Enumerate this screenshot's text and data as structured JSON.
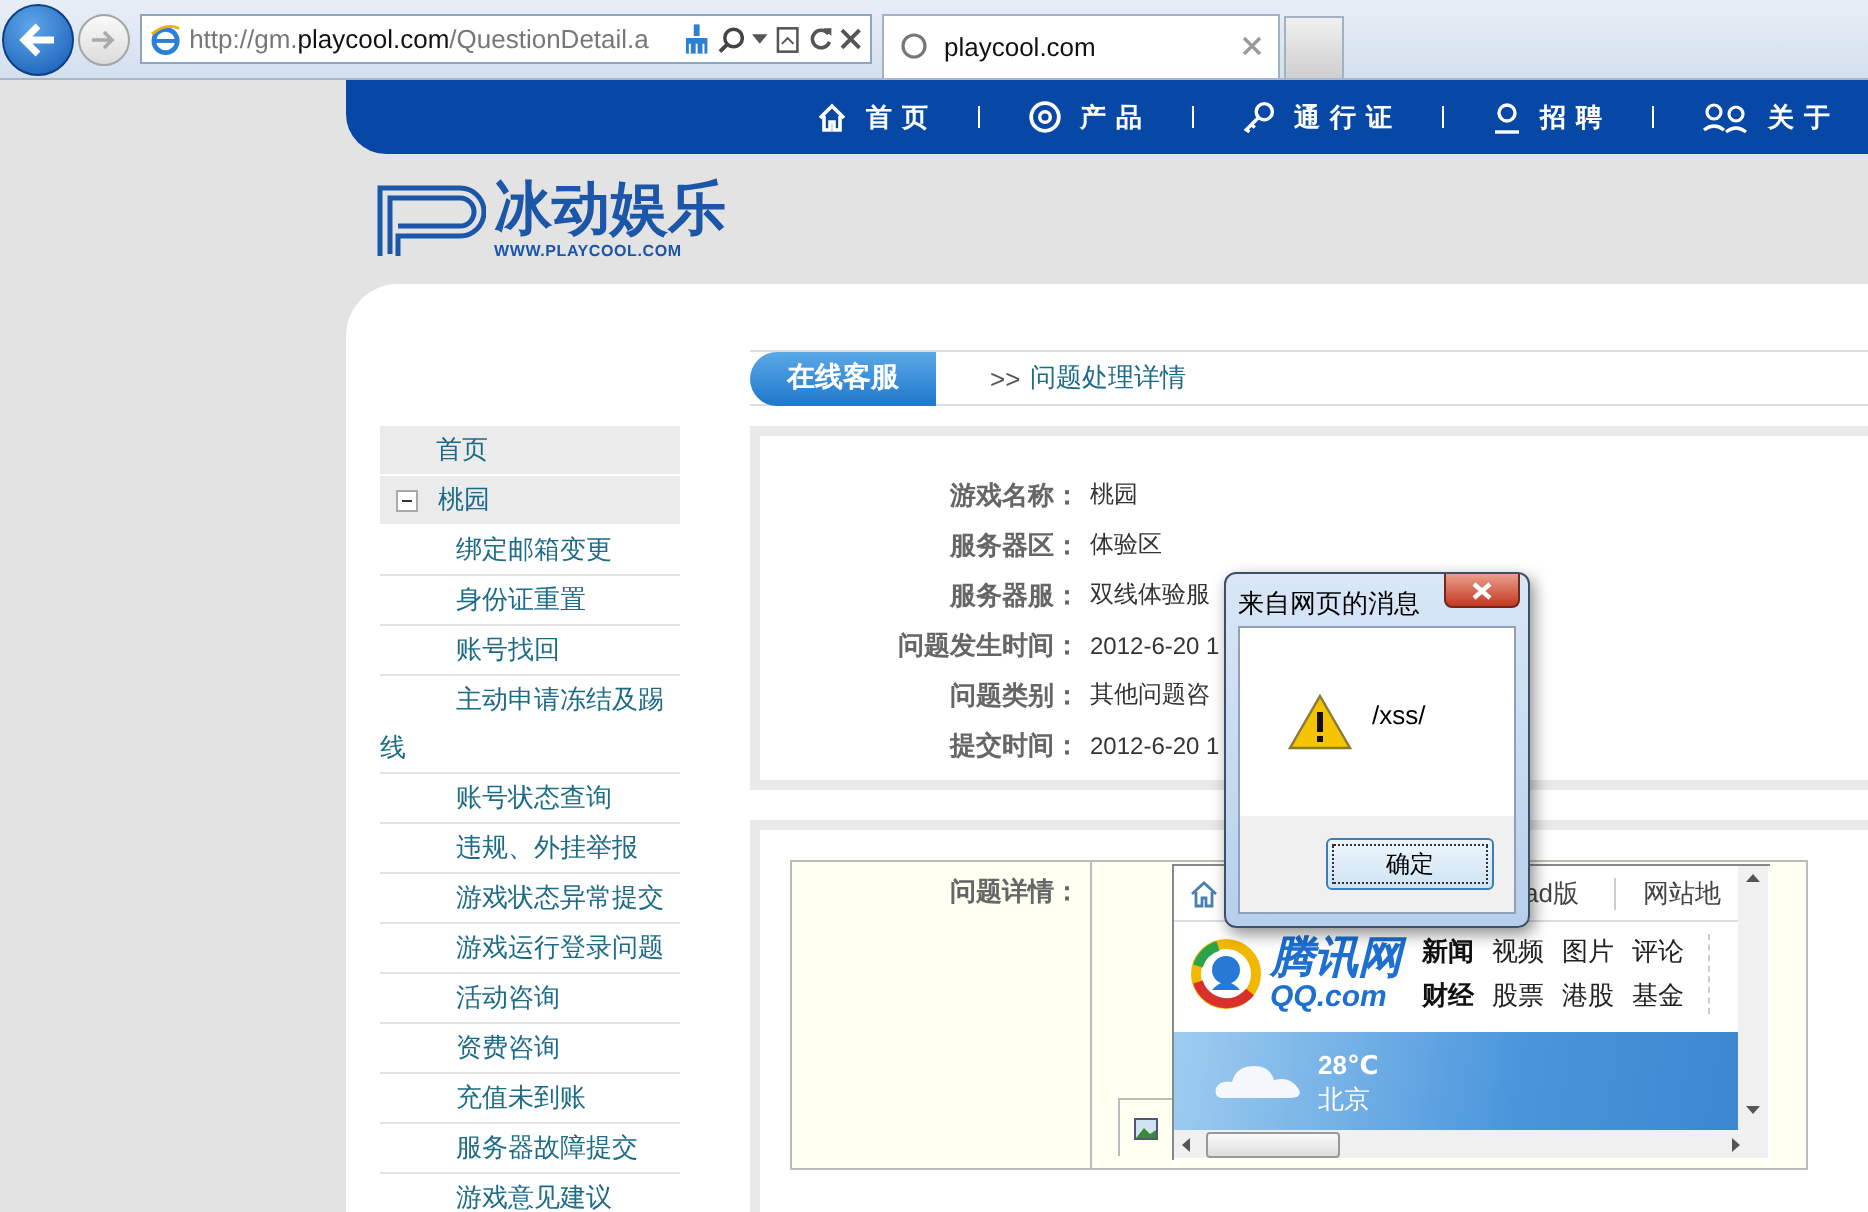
{
  "browser": {
    "url": {
      "prefix": "http://gm.",
      "domain": "playcool.com",
      "path": "/QuestionDetail.a"
    },
    "tab": {
      "title": "playcool.com"
    }
  },
  "nav": [
    {
      "kind": "home",
      "label": "首页"
    },
    {
      "kind": "product",
      "label": "产品"
    },
    {
      "kind": "pass",
      "label": "通行证"
    },
    {
      "kind": "jobs",
      "label": "招聘"
    },
    {
      "kind": "about",
      "label": "关于"
    }
  ],
  "logo": {
    "name": "冰动娱乐",
    "site": "WWW.PLAYCOOL.COM"
  },
  "sidebar": {
    "items": [
      {
        "label": "首页"
      },
      {
        "label": "桃园",
        "expanded": true,
        "children": [
          {
            "label": "绑定邮箱变更"
          },
          {
            "label": "身份证重置"
          },
          {
            "label": "账号找回"
          },
          {
            "label": "主动申请冻结及踢线"
          },
          {
            "label": "账号状态查询"
          },
          {
            "label": "违规、外挂举报"
          },
          {
            "label": "游戏状态异常提交"
          },
          {
            "label": "游戏运行登录问题"
          },
          {
            "label": "活动咨询"
          },
          {
            "label": "资费咨询"
          },
          {
            "label": "充值未到账"
          },
          {
            "label": "服务器故障提交"
          },
          {
            "label": "游戏意见建议"
          }
        ]
      }
    ]
  },
  "breadcrumb": {
    "section": "在线客服",
    "prefix": ">>",
    "page": "问题处理详情"
  },
  "details": [
    {
      "label": "游戏名称：",
      "value": "桃园"
    },
    {
      "label": "服务器区：",
      "value": "体验区"
    },
    {
      "label": "服务器服：",
      "value": "双线体验服"
    },
    {
      "label": "问题发生时间：",
      "value": "2012-6-20 1"
    },
    {
      "label": "问题类别：",
      "value": "其他问题咨"
    },
    {
      "label": "提交时间：",
      "value": "2012-6-20 1"
    }
  ],
  "question": {
    "label": "问题详情：",
    "embedded_page": {
      "top_links": [
        "ad版",
        "网站地"
      ],
      "logo_name": "腾讯网",
      "logo_domain": "QQ.com",
      "links": [
        [
          {
            "label": "新闻",
            "emphasized": true
          },
          {
            "label": "视频",
            "emphasized": false
          },
          {
            "label": "图片",
            "emphasized": false
          },
          {
            "label": "评论",
            "emphasized": false
          }
        ],
        [
          {
            "label": "财经",
            "emphasized": true
          },
          {
            "label": "股票",
            "emphasized": false
          },
          {
            "label": "港股",
            "emphasized": false
          },
          {
            "label": "基金",
            "emphasized": false
          }
        ]
      ],
      "weather": {
        "temperature": "28℃",
        "city": "北京"
      }
    }
  },
  "dialog": {
    "title": "来自网页的消息",
    "message": "/xss/",
    "button": "确定"
  }
}
